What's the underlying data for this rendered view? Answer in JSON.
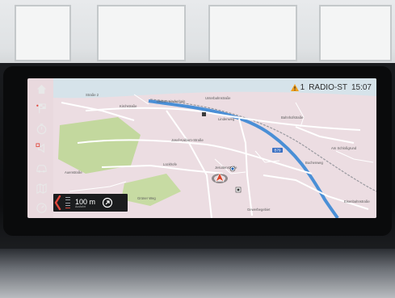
{
  "status": {
    "warning_count": "1",
    "source": "RADIO-ST",
    "time": "15:07"
  },
  "sidebar": {
    "items": [
      {
        "icon": "home-icon"
      },
      {
        "icon": "destination-flag-icon"
      },
      {
        "icon": "timer-icon"
      },
      {
        "icon": "audio-icon"
      },
      {
        "icon": "car-icon"
      },
      {
        "icon": "map-icon"
      },
      {
        "icon": "speedometer-icon"
      }
    ]
  },
  "map": {
    "labels": {
      "north_street": "Straße 2",
      "street_a": "Kirchstraße",
      "street_b": "Unterm Lindenhain",
      "street_c": "Unterbahnstraße",
      "street_d": "Lindenweg",
      "street_e": "Josef-Kaiburn-Straße",
      "street_f": "Jesuitenstraße",
      "street_g": "Bahnhofstraße",
      "district": "Lückhofe",
      "street_h": "Grüner Weg",
      "street_i": "Am Schloßgrund",
      "street_j": "Buchenweg",
      "street_k": "Eisenbahnstraße",
      "street_l": "Gewerbegebiet",
      "highway_badge": "B79",
      "street_m": "Auenstraße"
    },
    "colors": {
      "road_area": "#e9dbe0",
      "park": "#bfd79a",
      "river": "#4a8fd6",
      "route_position": "#d9452b"
    }
  },
  "guidance": {
    "distance": "100 m",
    "sub_label": "Ausfahrt"
  }
}
